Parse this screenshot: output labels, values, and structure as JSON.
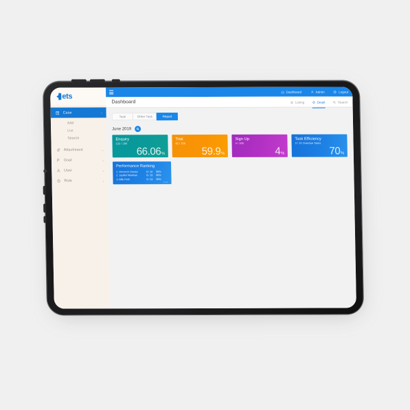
{
  "app": {
    "logo_text": "ets",
    "page_title": "Dashboard"
  },
  "topnav": {
    "items": [
      {
        "label": "Dashboard",
        "icon": "home-icon"
      },
      {
        "label": "Admin",
        "icon": "user-icon"
      },
      {
        "label": "Logout",
        "icon": "logout-icon"
      }
    ]
  },
  "viewtabs": {
    "items": [
      {
        "label": "Listing",
        "icon": "list-icon",
        "active": false
      },
      {
        "label": "Detail",
        "icon": "detail-icon",
        "active": true
      },
      {
        "label": "Search",
        "icon": "search-icon",
        "active": false
      }
    ]
  },
  "sidebar": {
    "primary": {
      "label": "Case",
      "icon": "case-icon",
      "chevron": "⌄"
    },
    "subitems": [
      {
        "label": "Add"
      },
      {
        "label": "List"
      },
      {
        "label": "Search"
      }
    ],
    "items": [
      {
        "label": "Attachment",
        "icon": "attachment-icon",
        "chevron": "›"
      },
      {
        "label": "Goal",
        "icon": "goal-icon",
        "chevron": "›"
      },
      {
        "label": "User",
        "icon": "user-icon",
        "chevron": "›"
      },
      {
        "label": "Role",
        "icon": "role-icon",
        "chevron": "›"
      }
    ]
  },
  "tabs": [
    {
      "label": "Task",
      "active": false
    },
    {
      "label": "Other Task",
      "active": false
    },
    {
      "label": "Report",
      "active": true
    }
  ],
  "filter": {
    "month": "June 2019",
    "button_icon": "search-icon"
  },
  "cards": [
    {
      "title": "Enquiry",
      "sub": "132 / 200",
      "value": "66.06",
      "unit": "%",
      "color": "#0c9a98"
    },
    {
      "title": "Trial",
      "sub": "82 / 150",
      "value": "59.9",
      "unit": "%",
      "color": "#f99405"
    },
    {
      "title": "Sign Up",
      "sub": "4 / 100",
      "value": "4",
      "unit": "%",
      "color": "#b331c4"
    },
    {
      "title": "Task Efficiency",
      "sub": "3 / 10 Overdue Tasks",
      "value": "70",
      "unit": "%",
      "color": "#1d80e4"
    }
  ],
  "ranking": {
    "title": "Performance Ranking",
    "rows": [
      {
        "name": "1. Vincenzo Graves",
        "score": "8 / 10",
        "pct": "80%"
      },
      {
        "name": "2. Jayden Newman",
        "score": "8 / 10",
        "pct": "80%"
      },
      {
        "name": "3. Billy Hunt",
        "score": "8 / 10",
        "pct": "80%"
      }
    ],
    "footnote": "more"
  },
  "colors": {
    "accent": "#1a86e8",
    "sidebar_bg": "#f7f1ea",
    "page_bg": "#f2f2f2"
  }
}
